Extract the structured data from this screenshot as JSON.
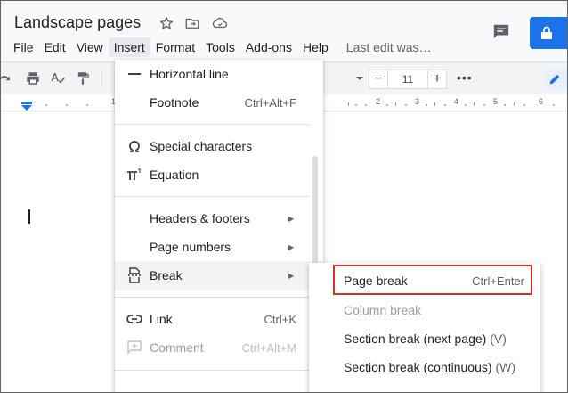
{
  "doc": {
    "title": "Landscape pages"
  },
  "menubar": {
    "items": [
      "File",
      "Edit",
      "View",
      "Insert",
      "Format",
      "Tools",
      "Add-ons",
      "Help"
    ],
    "last_edit": "Last edit was…"
  },
  "toolbar": {
    "font_size": "11",
    "minus": "−",
    "plus": "+",
    "more": "•••"
  },
  "ruler": {
    "numbers": [
      "1",
      "1",
      "2",
      "3",
      "4",
      "5",
      "6"
    ]
  },
  "insert_menu": {
    "items": [
      {
        "label": "Horizontal line",
        "shortcut": "",
        "icon": "horizontal-line-icon",
        "disabled": false
      },
      {
        "label": "Footnote",
        "shortcut": "Ctrl+Alt+F",
        "icon": "",
        "disabled": false
      },
      {
        "label": "Special characters",
        "shortcut": "",
        "icon": "omega-icon",
        "disabled": false
      },
      {
        "label": "Equation",
        "shortcut": "",
        "icon": "pi-icon",
        "disabled": false
      },
      {
        "label": "Headers & footers",
        "shortcut": "",
        "icon": "",
        "disabled": false,
        "submenu": true
      },
      {
        "label": "Page numbers",
        "shortcut": "",
        "icon": "",
        "disabled": false,
        "submenu": true
      },
      {
        "label": "Break",
        "shortcut": "",
        "icon": "break-icon",
        "disabled": false,
        "submenu": true,
        "highlighted": true
      },
      {
        "label": "Link",
        "shortcut": "Ctrl+K",
        "icon": "link-icon",
        "disabled": false
      },
      {
        "label": "Comment",
        "shortcut": "Ctrl+Alt+M",
        "icon": "comment-add-icon",
        "disabled": true
      }
    ]
  },
  "break_submenu": {
    "page_break": {
      "label": "Page break",
      "shortcut": "Ctrl+Enter"
    },
    "column_break": {
      "label": "Column break"
    },
    "section_next": {
      "label": "Section break (next page)",
      "hint": "(V)"
    },
    "section_cont": {
      "label": "Section break (continuous)",
      "hint": "(W)"
    }
  },
  "colors": {
    "accent": "#1a73e8",
    "highlight_box": "#d93025"
  }
}
